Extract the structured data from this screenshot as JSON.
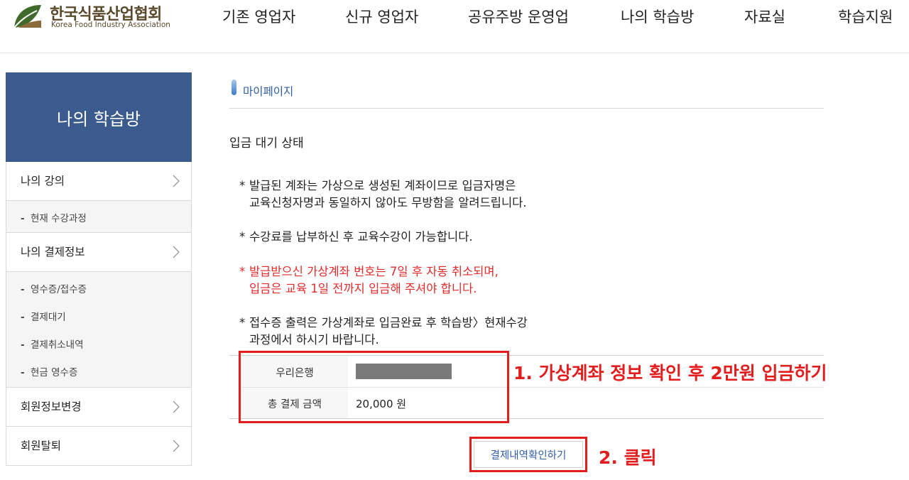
{
  "header": {
    "logo_kr": "한국식품산업협회",
    "logo_en": "Korea Food Industry Association",
    "nav": [
      "기존 영업자",
      "신규 영업자",
      "공유주방 운영업",
      "나의 학습방",
      "자료실",
      "학습지원"
    ]
  },
  "sidebar": {
    "title": "나의 학습방",
    "items": [
      {
        "label": "나의 강의",
        "subitems": [
          "현재 수강과정"
        ]
      },
      {
        "label": "나의 결제정보",
        "subitems": [
          "영수증/접수증",
          "결제대기",
          "결제취소내역",
          "현금 영수증"
        ]
      },
      {
        "label": "회원정보변경"
      },
      {
        "label": "회원탈퇴"
      }
    ]
  },
  "main": {
    "breadcrumb": "마이페이지",
    "section_title": "입금 대기 상태",
    "notes": [
      {
        "lines": [
          "발급된 계좌는 가상으로 생성된 계좌이므로 입금자명은",
          "교육신청자명과 동일하지 않아도 무방함을 알려드립니다."
        ],
        "emphasis": false
      },
      {
        "lines": [
          "수강료를 납부하신 후 교육수강이 가능합니다."
        ],
        "emphasis": false
      },
      {
        "lines": [
          "발급받으신 가상계좌 번호는 7일 후 자동 취소되며,",
          "입금은 교육 1일 전까지 입금해 주셔야 합니다."
        ],
        "emphasis": true
      },
      {
        "lines": [
          "접수증 출력은 가상계좌로 입금완료 후 학습방〉현재수강",
          "과정에서 하시기 바랍니다."
        ],
        "emphasis": false
      }
    ],
    "star": "*",
    "payment": {
      "bank_label": "우리은행",
      "total_label": "총 결제 금액",
      "total_value": "20,000 원"
    },
    "confirm_button": "결제내역확인하기"
  },
  "annotations": {
    "step1": "1. 가상계좌 정보 확인 후 2만원 입금하기",
    "step2": "2. 클릭"
  },
  "colors": {
    "sidebar_title_bg": "#3b5a8e",
    "link_blue": "#2f5da7",
    "emphasis_red": "#e12b2b",
    "annotation_red": "#e31d1d"
  }
}
